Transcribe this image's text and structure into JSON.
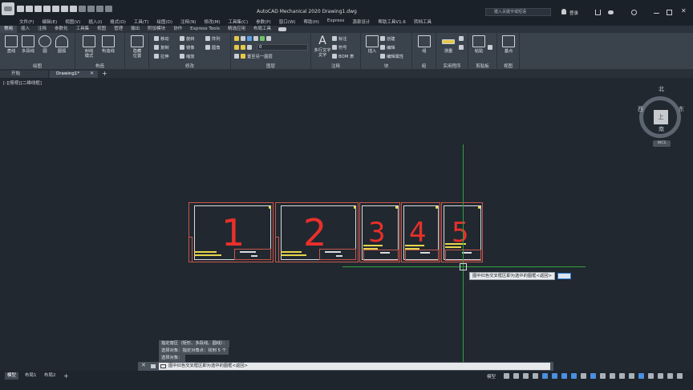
{
  "titlebar": {
    "window_title": "AutoCAD Mechanical 2020    Drawing1.dwg",
    "search_placeholder": "键入关键字或短语",
    "user_label": "登录"
  },
  "menu": [
    "文件(F)",
    "编辑(E)",
    "视图(V)",
    "插入(I)",
    "格式(O)",
    "工具(T)",
    "绘图(D)",
    "注释(N)",
    "修改(M)",
    "工具集(C)",
    "参数(P)",
    "窗口(W)",
    "帮助(H)",
    "Express",
    "源泉设计",
    "帮助工具V1.6",
    "转档工具"
  ],
  "ribbon_tabs": [
    "常用",
    "插入",
    "注释",
    "参数化",
    "工具集",
    "视图",
    "管理",
    "输出",
    "附加模块",
    "协作",
    "Express Tools",
    "精选应用",
    "布局工具"
  ],
  "ribbon": {
    "draw": {
      "title": "绘图",
      "line": "直线",
      "polyline": "多段线",
      "circle": "圆",
      "arc": "圆弧"
    },
    "construct": {
      "title": "构造",
      "ray": "射线",
      "construct_line": "构造线",
      "construct_line_sub": "模式"
    },
    "hide": {
      "label": "隐藏",
      "label2": "位置"
    },
    "modify": {
      "title": "修改",
      "move": "移动",
      "rotate": "旋转",
      "array": "阵列",
      "copy": "复制",
      "mirror": "镜像",
      "fillet": "圆角",
      "stretch": "拉伸",
      "scale": "缩放"
    },
    "layers": {
      "title": "图层",
      "current_layer": "0",
      "match": "置至另一图层"
    },
    "annotation": {
      "title": "注释",
      "multiline_text": "多行文字",
      "multiline_text2": "文字",
      "dimension": "标注",
      "symbol": "符号",
      "bom": "BOM 表"
    },
    "block": {
      "title": "块",
      "insert": "插入",
      "create": "创建",
      "edit": "编辑",
      "edit_attr": "编辑属性"
    },
    "group": {
      "title": "组",
      "label": "组"
    },
    "utilities": {
      "title": "实用程序",
      "measure": "测量"
    },
    "clipboard": {
      "title": "剪贴板",
      "paste": "粘贴",
      "copy_clip": "复制"
    },
    "view": {
      "title": "视图",
      "base_point": "基点"
    }
  },
  "file_tabs": {
    "start": "开始",
    "drawing": "Drawing1*"
  },
  "viewport_label": "[-][俯视][二维线框]",
  "viewcube": {
    "top": "上",
    "north": "北",
    "south": "南",
    "west": "西",
    "east": "东",
    "wcs": "WCS"
  },
  "frames": [
    "1",
    "2",
    "3",
    "4",
    "5"
  ],
  "tooltip": "图中红色交叉框区即为选中的图框<返回>",
  "command_history": [
    "指定窗区（矩形、多段线、圆线）：",
    "选择对象：指定对角点：找到 5 个",
    "选择对象："
  ],
  "command_line": "图中红色交叉框区即为选中的图框<返回>",
  "status": {
    "model_tab": "模型",
    "layout1": "布局1",
    "layout2": "布局2",
    "add": "+",
    "model_label": "模型"
  }
}
